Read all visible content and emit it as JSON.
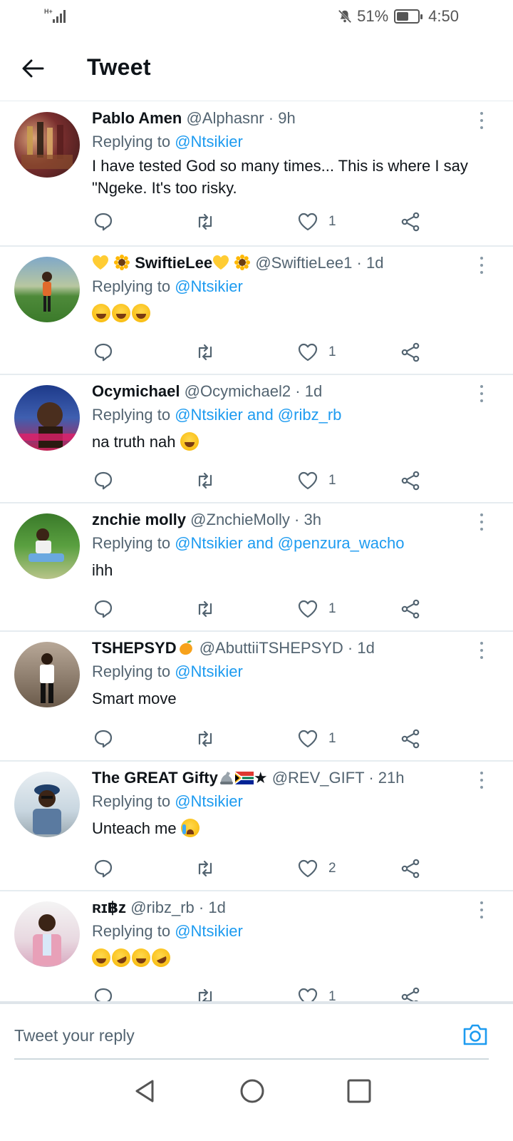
{
  "status_bar": {
    "network": "H+",
    "battery": "51%",
    "time": "4:50"
  },
  "header": {
    "title": "Tweet"
  },
  "replying_prefix": "Replying to",
  "tweets": [
    {
      "name": "Pablo Amen",
      "handle": "@Alphasnr",
      "time": "9h",
      "mentions": "@Ntsikier",
      "text": "I have tested God so many times... This is where I say \"Ngeke. It's too risky.",
      "likes": "1"
    },
    {
      "name": "SwiftieLee",
      "handle": "@SwiftieLee1",
      "time": "1d",
      "mentions": "@Ntsikier",
      "text": "",
      "emojis": [
        "face-with-tears-of-joy",
        "face-with-tears-of-joy",
        "face-with-tears-of-joy"
      ],
      "likes": "1"
    },
    {
      "name": "Ocymichael",
      "handle": "@Ocymichael2",
      "time": "1d",
      "mentions": "@Ntsikier and @ribz_rb",
      "text": "na truth nah",
      "likes": "1"
    },
    {
      "name": "znchie molly",
      "handle": "@ZnchieMolly",
      "time": "3h",
      "mentions": "@Ntsikier and @penzura_wacho",
      "text": "ihh",
      "likes": "1"
    },
    {
      "name": "TSHEPSYD",
      "handle": "@AbuttiiTSHEPSYD",
      "time": "1d",
      "mentions": "@Ntsikier",
      "text": "Smart move",
      "likes": "1"
    },
    {
      "name": "The GREAT Gifty",
      "name_suffix": "★",
      "handle": "@REV_GIFT",
      "time": "21h",
      "mentions": "@Ntsikier",
      "text": "Unteach me",
      "likes": "2"
    },
    {
      "name": "ʀɪ฿z",
      "handle": "@ribz_rb",
      "time": "1d",
      "mentions": "@Ntsikier",
      "text": "",
      "emojis": [
        "face-with-tears-of-joy",
        "rolling-on-the-floor-laughing",
        "face-with-tears-of-joy",
        "rolling-on-the-floor-laughing"
      ],
      "likes": "1"
    }
  ],
  "reply_bar": {
    "placeholder": "Tweet your reply"
  },
  "icons": {
    "back": "arrow-left-icon",
    "reply": "comment-icon",
    "retweet": "retweet-icon",
    "like": "heart-icon",
    "share": "share-icon",
    "more": "more-vertical-icon",
    "camera": "camera-icon"
  },
  "colors": {
    "link": "#1d9bf0",
    "secondary_text": "#536471",
    "divider": "#e6ecf0"
  }
}
